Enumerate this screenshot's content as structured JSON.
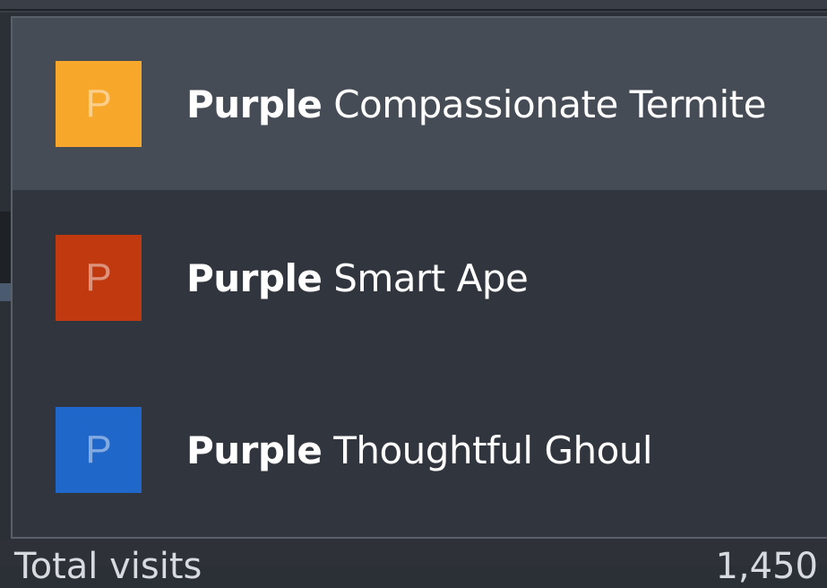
{
  "dropdown": {
    "options": [
      {
        "initial": "P",
        "bold": "Purple",
        "rest": " Compassionate Termite",
        "color": "#f7a72a",
        "highlighted": true
      },
      {
        "initial": "P",
        "bold": "Purple",
        "rest": " Smart Ape",
        "color": "#c0390f",
        "highlighted": false
      },
      {
        "initial": "P",
        "bold": "Purple",
        "rest": " Thoughtful Ghoul",
        "color": "#1f67c9",
        "highlighted": false
      }
    ]
  },
  "background": {
    "bottom_label": "Total visits",
    "bottom_value": "1,450"
  }
}
